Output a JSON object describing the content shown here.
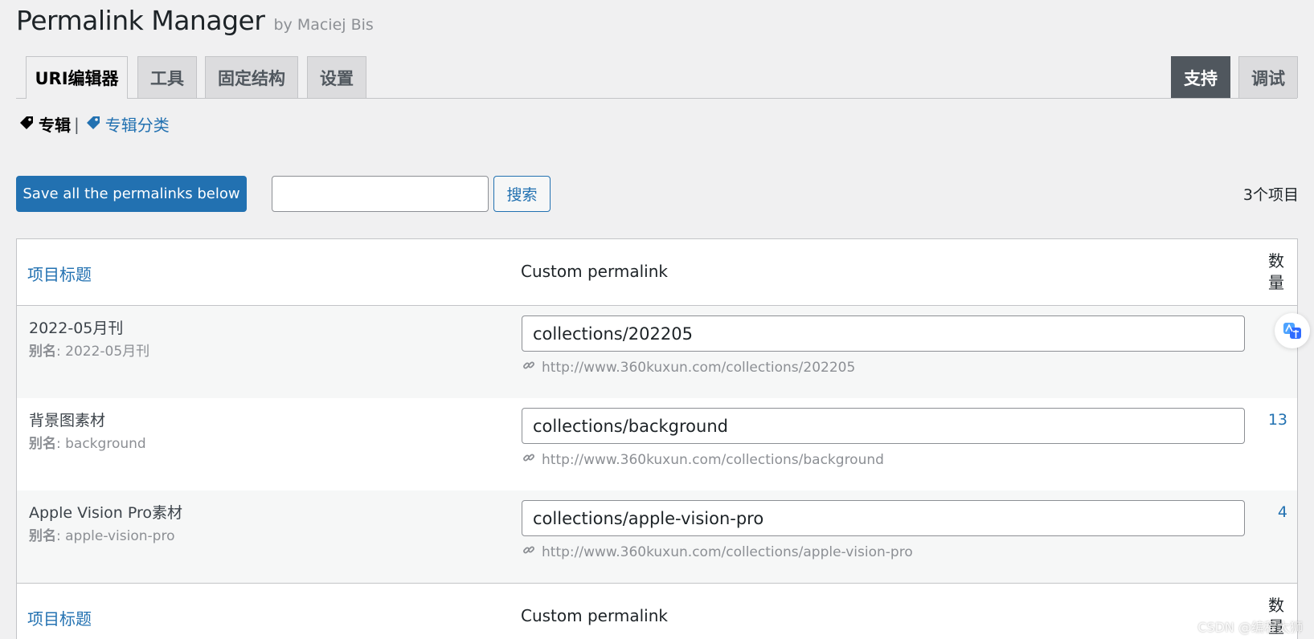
{
  "header": {
    "title": "Permalink Manager",
    "author": "by Maciej Bis"
  },
  "tabs": [
    {
      "label": "URI编辑器",
      "active": true
    },
    {
      "label": "工具"
    },
    {
      "label": "固定结构"
    },
    {
      "label": "设置"
    }
  ],
  "tabs_right": [
    {
      "label": "支持",
      "style": "dark"
    },
    {
      "label": "调试"
    }
  ],
  "subnav": {
    "current": "专辑",
    "separator": "|",
    "link": "专辑分类",
    "icon": "tag-icon"
  },
  "toolbar": {
    "save_label": "Save all the permalinks below",
    "search_value": "",
    "search_button": "搜索",
    "count_text": "3个项目"
  },
  "table": {
    "columns": {
      "title": "项目标题",
      "permalink": "Custom permalink",
      "count": "数量"
    },
    "slug_label": "别名",
    "rows": [
      {
        "title": "2022-05月刊",
        "slug": ": 2022-05月刊",
        "permalink": "collections/202205",
        "url": "http://www.360kuxun.com/collections/202205",
        "count": ""
      },
      {
        "title": "背景图素材",
        "slug": ": background",
        "permalink": "collections/background",
        "url": "http://www.360kuxun.com/collections/background",
        "count": "13"
      },
      {
        "title": "Apple Vision Pro素材",
        "slug": ": apple-vision-pro",
        "permalink": "collections/apple-vision-pro",
        "url": "http://www.360kuxun.com/collections/apple-vision-pro",
        "count": "4"
      }
    ]
  },
  "watermark": "CSDN @编程太狮",
  "colors": {
    "accent": "#2271b1",
    "background": "#f0f0f1",
    "dark_tab": "#50575e",
    "muted_text": "#8c8f94"
  }
}
